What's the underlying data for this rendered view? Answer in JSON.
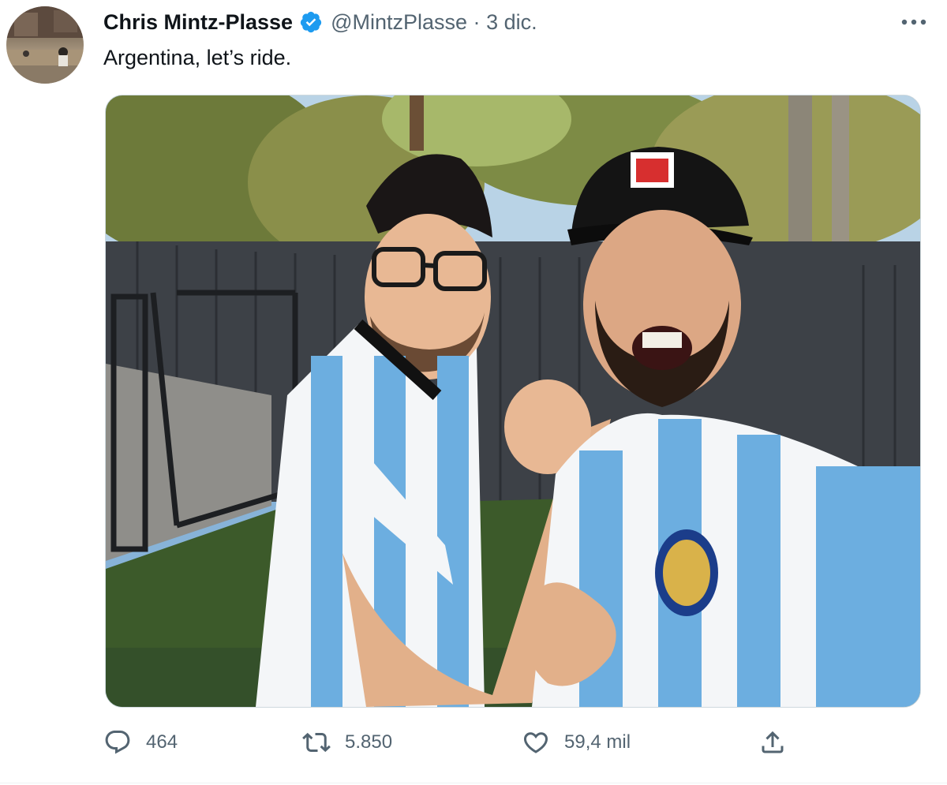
{
  "tweet": {
    "author_name": "Chris Mintz-Plasse",
    "handle": "@MintzPlasse",
    "separator": "·",
    "date": "3 dic.",
    "text": "Argentina, let’s ride."
  },
  "actions": {
    "replies": "464",
    "retweets": "5.850",
    "likes": "59,4 mil"
  },
  "icons": {
    "verified": "verified-badge-icon",
    "more": "more-icon",
    "reply": "reply-icon",
    "retweet": "retweet-icon",
    "like": "heart-icon",
    "share": "share-icon"
  },
  "colors": {
    "brand_blue": "#1d9bf0",
    "secondary_text": "#536471",
    "primary_text": "#0f1419"
  }
}
